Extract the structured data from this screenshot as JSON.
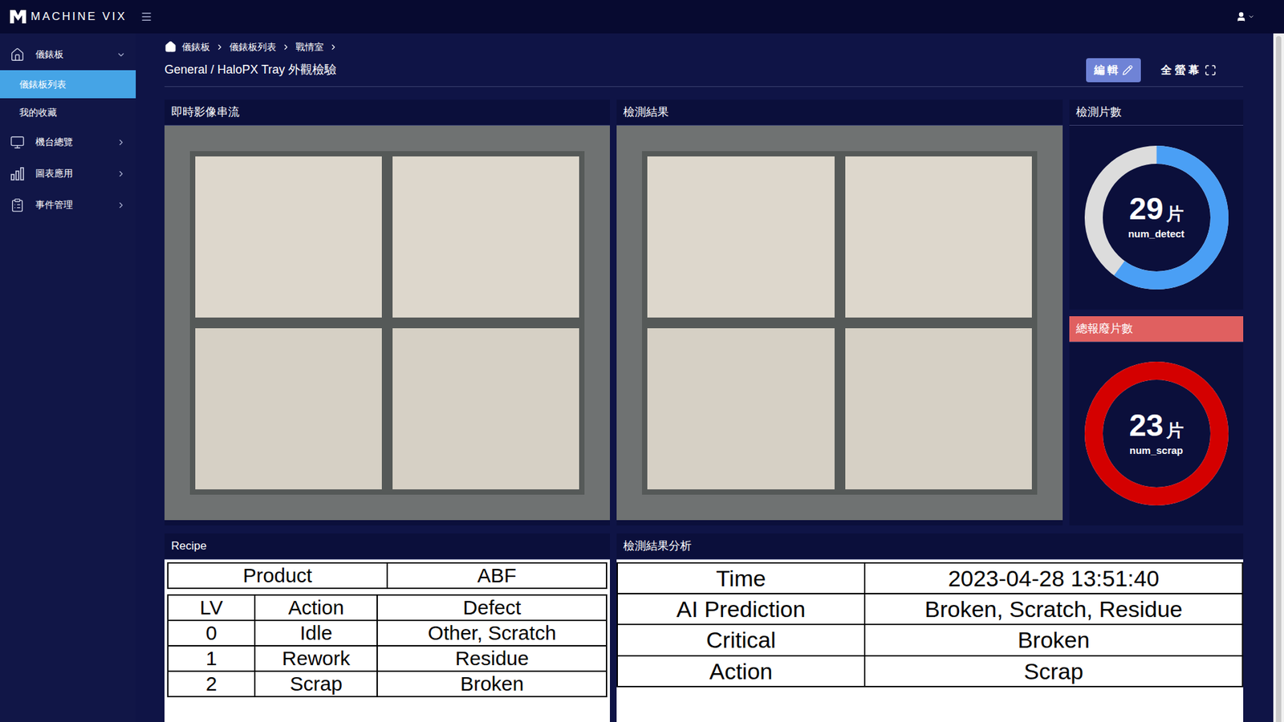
{
  "header": {
    "logo": "MACHINE VIX"
  },
  "sidebar": {
    "items": [
      {
        "label": "儀錶板",
        "kind": "group",
        "expanded": true,
        "selected": false
      },
      {
        "label": "儀錶板列表",
        "kind": "sub",
        "expanded": false,
        "selected": true
      },
      {
        "label": "我的收藏",
        "kind": "sub",
        "expanded": false,
        "selected": false
      },
      {
        "label": "機台總覽",
        "kind": "group",
        "expanded": false,
        "selected": false
      },
      {
        "label": "圖表應用",
        "kind": "group",
        "expanded": false,
        "selected": false
      },
      {
        "label": "事件管理",
        "kind": "group",
        "expanded": false,
        "selected": false
      }
    ]
  },
  "breadcrumb": [
    "儀錶板",
    "儀錶板列表",
    "戰情室"
  ],
  "page": {
    "title": "General / HaloPX Tray 外觀檢驗",
    "buttons": [
      {
        "label": "編 輯",
        "kind": "primary"
      },
      {
        "label": "全 螢 幕",
        "kind": "plain"
      }
    ]
  },
  "live": {
    "title": "即時影像串流"
  },
  "result": {
    "title": "檢測結果"
  },
  "gauges": [
    {
      "title": "檢測片數",
      "value": "29",
      "unit": "片",
      "metric": "num_detect",
      "level": 0.6,
      "color": "#4a9ff5",
      "alert": false
    },
    {
      "title": "總報廢片數",
      "value": "23",
      "unit": "片",
      "metric": "num_scrap",
      "level": 1,
      "color": "#d40000",
      "alert": true
    }
  ],
  "recipe": {
    "title": "Recipe",
    "product": {
      "label": "Product",
      "value": "ABF"
    },
    "columns": [
      "LV",
      "Action",
      "Defect"
    ],
    "rows": [
      [
        "0",
        "Idle",
        "Other, Scratch"
      ],
      [
        "1",
        "Rework",
        "Residue"
      ],
      [
        "2",
        "Scrap",
        "Broken"
      ]
    ]
  },
  "analysis": {
    "title": "檢測結果分析",
    "rows": [
      [
        "Time",
        "2023-04-28 13:51:40"
      ],
      [
        "AI Prediction",
        "Broken, Scratch, Residue"
      ],
      [
        "Critical",
        "Broken"
      ],
      [
        "Action",
        "Scrap"
      ]
    ]
  }
}
